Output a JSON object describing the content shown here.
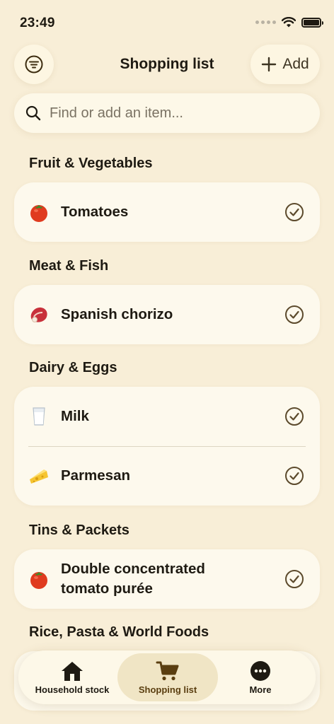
{
  "status": {
    "time": "23:49"
  },
  "header": {
    "title": "Shopping list",
    "add_label": "Add"
  },
  "search": {
    "placeholder": "Find or add an item..."
  },
  "sections": [
    {
      "title": "Fruit & Vegetables",
      "items": [
        {
          "name": "Tomatoes",
          "icon": "tomato-icon"
        }
      ]
    },
    {
      "title": "Meat & Fish",
      "items": [
        {
          "name": "Spanish chorizo",
          "icon": "meat-icon"
        }
      ]
    },
    {
      "title": "Dairy & Eggs",
      "items": [
        {
          "name": "Milk",
          "icon": "milk-icon"
        },
        {
          "name": "Parmesan",
          "icon": "cheese-icon"
        }
      ]
    },
    {
      "title": "Tins & Packets",
      "items": [
        {
          "name": "Double concentrated tomato purée",
          "icon": "tomato-icon"
        }
      ]
    },
    {
      "title": "Rice, Pasta & World Foods",
      "items": []
    }
  ],
  "nav": {
    "household": "Household stock",
    "shopping": "Shopping list",
    "more": "More"
  },
  "colors": {
    "background": "#f8eed7",
    "card": "#fdf9ed",
    "accent": "#5a3e10",
    "check": "#5c4a2c"
  }
}
